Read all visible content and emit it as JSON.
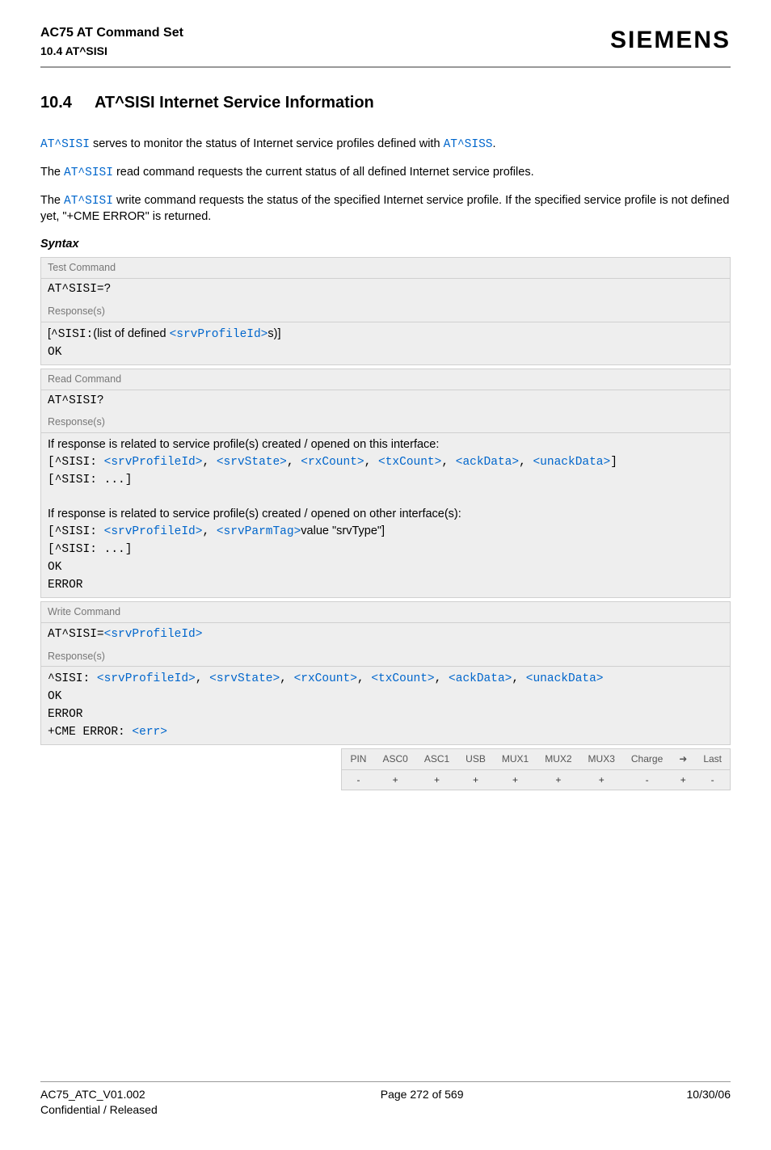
{
  "header": {
    "title": "AC75 AT Command Set",
    "sub": "10.4 AT^SISI",
    "brand": "SIEMENS"
  },
  "section": {
    "num": "10.4",
    "title": "AT^SISI   Internet Service Information"
  },
  "intro": {
    "p1a": "AT^SISI",
    "p1b": " serves to monitor the status of Internet service profiles defined with ",
    "p1c": "AT^SISS",
    "p1d": ".",
    "p2a": "The ",
    "p2b": "AT^SISI",
    "p2c": " read command requests the current status of all defined Internet service profiles.",
    "p3a": "The ",
    "p3b": "AT^SISI",
    "p3c": " write command requests the status of the specified Internet service profile. If the specified service profile is not defined yet, \"+CME ERROR\" is returned."
  },
  "syntax": {
    "label": "Syntax",
    "test": {
      "head": "Test Command",
      "cmd": "AT^SISI=?",
      "resp_head": "Response(s)",
      "r1a": "[",
      "r1b": "^SISI:",
      "r1c": "(list of defined ",
      "r1d": "<srvProfileId>",
      "r1e": "s)]",
      "r2": "OK"
    },
    "read": {
      "head": "Read Command",
      "cmd": "AT^SISI?",
      "resp_head": "Response(s)",
      "note1": "If response is related to service profile(s) created / opened on this interface:",
      "l1_open": "[",
      "l1_tag": "^SISI: ",
      "p_srvProfileId": "<srvProfileId>",
      "p_srvState": "<srvState>",
      "p_rxCount": "<rxCount>",
      "p_txCount": "<txCount>",
      "p_ackData": "<ackData>",
      "p_unackData": "<unackData>",
      "l1_close": "]",
      "l2": "[^SISI: ...]",
      "note2": "If response is related to service profile(s) created / opened on other interface(s):",
      "l3_open": "[",
      "l3_tag": "^SISI: ",
      "p_srvParmTag": "<srvParmTag>",
      "l3_val": "value \"srvType\"]",
      "l4": "[^SISI: ...]",
      "l5": "OK",
      "l6": "ERROR"
    },
    "write": {
      "head": "Write Command",
      "cmd_pre": "AT^SISI=",
      "cmd_param": "<srvProfileId>",
      "resp_head": "Response(s)",
      "l1_tag": "^SISI: ",
      "l2": "OK",
      "l3": "ERROR",
      "l4a": "+CME ERROR: ",
      "l4b": "<err>"
    }
  },
  "caps": {
    "headers": [
      "PIN",
      "ASC0",
      "ASC1",
      "USB",
      "MUX1",
      "MUX2",
      "MUX3",
      "Charge",
      "➜",
      "Last"
    ],
    "values": [
      "-",
      "+",
      "+",
      "+",
      "+",
      "+",
      "+",
      "-",
      "+",
      "-"
    ]
  },
  "footer": {
    "doc": "AC75_ATC_V01.002",
    "conf": "Confidential / Released",
    "page": "Page 272 of 569",
    "date": "10/30/06"
  },
  "sep": ", "
}
